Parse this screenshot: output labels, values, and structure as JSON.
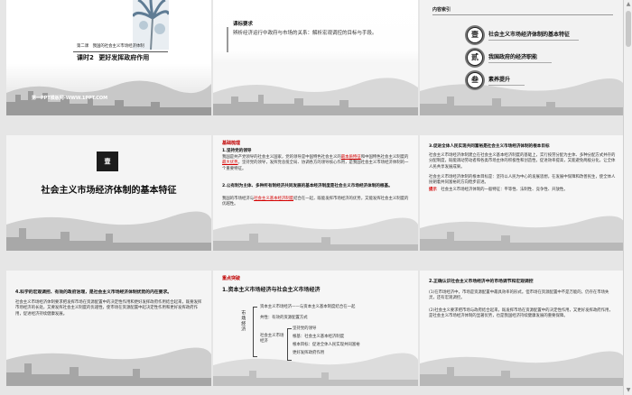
{
  "slides": [
    {
      "number": "1",
      "lesson_label": "第二课　我国的社会主义市场经济体制",
      "title_prefix": "课时2",
      "title": "更好发挥政府作用",
      "site": "第一PPT模板网-WWW.1PPT.COM"
    },
    {
      "number": "2",
      "section_heading": "课标要求",
      "body": "辨析经济运行中政府与市场的关系：解析宏观调控的目标与手段。"
    },
    {
      "number": "3",
      "header": "内容索引",
      "items": [
        {
          "glyph": "壹",
          "label": "社会主义市场经济体制的基本特征"
        },
        {
          "glyph": "贰",
          "label": "我国政府的经济职能"
        },
        {
          "glyph": "叁",
          "label": "素养提升"
        }
      ]
    },
    {
      "number": "4",
      "badge": "壹",
      "title": "社会主义市场经济体制的基本特征"
    },
    {
      "number": "5",
      "header": "基础梳理",
      "point1": "1.坚持党的领导",
      "p1a": "我国是共产党领导的社会主义国家，党的领导是中国特色社会主义的",
      "p1a_red": "最本质特征",
      "p1b": "和中国特色社会主义制度的",
      "p1b_red": "最大优势",
      "p1c": "。坚持党的领导，发挥党总揽全局、协调各方的领导核心作用，是我国社会主义市场经济体制的一个重要特征。",
      "point2": "2.公有制为主体、多种所有制经济共同发展的基本经济制度是社会主义市场经济体制的根基。",
      "p2a": "我国的市场经济与",
      "p2a_red": "社会主义基本经济制度",
      "p2b": "结合在一起，既能发挥市场经济的优势，又能发挥社会主义制度的优越性。"
    },
    {
      "number": "6",
      "point3": "3.促进全体人民实现共同富裕是社会主义市场经济体制的根本目标",
      "p3": "社会主义市场经济体制建立在社会主义基本经济制度的基础上，实行按劳分配为主体、多种分配方式并存的分配制度，既能调动劳动者和各类市场主体的积极性和创造性，促进效率提高，又能避免两极分化，让全体人民共享发展成果。",
      "p3b": "社会主义市场经济体制的根本目标是：坚持以人民为中心的发展思想，在发展中保障和改善民生，使全体人民朝着共同富裕的方向稳步前进。",
      "note_label": "提示",
      "note": "社会主义市场经济体制的一般特征：平等性、法制性、竞争性、开放性。"
    },
    {
      "number": "7",
      "point4": "4.科学的宏观调控、有效的政府治理，是社会主义市场经济体制优势的内在要求。",
      "p4": "社会主义市场经济体制要求把发挥市场在资源配置中的决定性作用和更好发挥政府作用结合起来，既要发挥市场经济的长处，又要发挥社会主义制度的优越性，使市场在资源配置中起决定性作用和更好发挥政府作用，促进经济持续健康发展。"
    },
    {
      "number": "8",
      "header": "重点突破",
      "title": "1.资本主义市场经济与社会主义市场经济",
      "root": "市场经济",
      "branch1": "资本主义市场经济——与资本主义基本制度结合在一起",
      "branch2": "共性：有效的资源配置方式",
      "branch3": "社会主义市场经济",
      "leaves": [
        "坚持党的领导",
        "根基：社会主义基本经济制度",
        "根本目标：促进全体人民实现共同富裕",
        "更好发挥政府作用"
      ]
    },
    {
      "number": "9",
      "title": "2.正确认识社会主义市场经济中的市场调节和宏观调控",
      "p1": "(1)在市场经济中，市场是资源配置中最具效率的形式。但市场在资源配置中不是万能的，仍存在市场失灵，还有宏观调控。",
      "p2": "(2)社会主义要求把市场与政府结合起来，既发挥市场在资源配置中的决定性作用，又更好发挥政府作用，是社会主义市场经济体制的显著优势，也是我国经济持续健康发展的重要保障。"
    }
  ]
}
